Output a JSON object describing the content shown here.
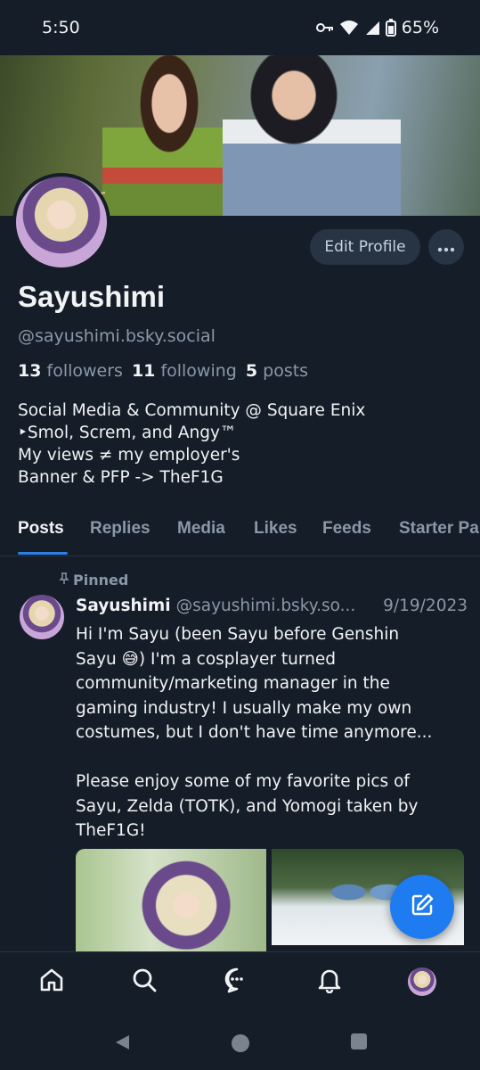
{
  "status": {
    "time": "5:50",
    "battery": "65%"
  },
  "profile": {
    "display_name": "Sayushimi",
    "handle": "@sayushimi.bsky.social",
    "followers_count": "13",
    "followers_label": "followers",
    "following_count": "11",
    "following_label": "following",
    "posts_count": "5",
    "posts_label": "posts",
    "bio": [
      "Social Media & Community @ Square Enix",
      "‣Smol, Screm, and Angy™",
      "My views ≠ my employer's",
      "Banner & PFP -> TheF1G"
    ],
    "edit_label": "Edit Profile"
  },
  "tabs": [
    "Posts",
    "Replies",
    "Media",
    "Likes",
    "Feeds",
    "Starter Pa"
  ],
  "post": {
    "pinned_label": "Pinned",
    "author": "Sayushimi",
    "handle": "@sayushimi.bsky.so...",
    "date": "9/19/2023",
    "text": "Hi I'm Sayu (been Sayu before Genshin\nSayu 😅) I'm a cosplayer turned\ncommunity/marketing manager in the\ngaming industry! I usually make my own\ncostumes, but I don't have time anymore...\n\nPlease enjoy some of my favorite pics of\nSayu, Zelda (TOTK), and Yomogi taken by\nTheF1G!"
  },
  "nav": [
    "home-icon",
    "search-icon",
    "chat-icon",
    "bell-icon",
    "profile-avatar"
  ],
  "colors": {
    "accent": "#1e7bf0",
    "background": "#151d28",
    "muted": "#8a98a8"
  }
}
